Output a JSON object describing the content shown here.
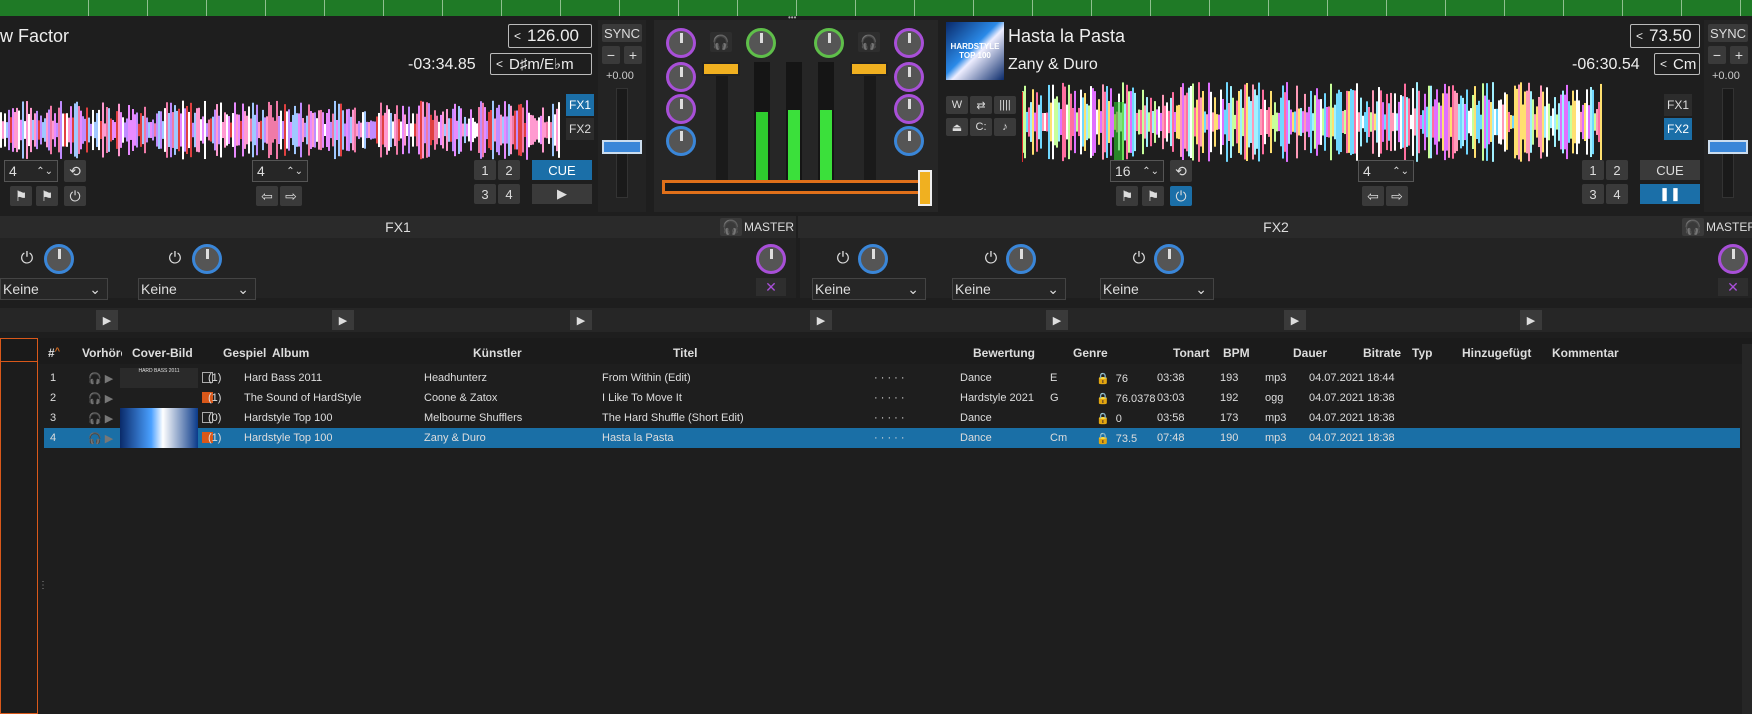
{
  "deck_left": {
    "title": "w Factor",
    "bpm": "126.00",
    "time": "-03:34.85",
    "key": "D♯m/E♭m",
    "pitch": "+0.00",
    "sync": "SYNC",
    "fx1": "FX1",
    "fx2": "FX2",
    "cue": "CUE",
    "loop_a": "4",
    "loop_b": "4",
    "hot": [
      "1",
      "2",
      "3",
      "4"
    ]
  },
  "deck_right": {
    "title": "Hasta la Pasta",
    "artist": "Zany & Duro",
    "bpm": "73.50",
    "time": "-06:30.54",
    "key": "Cm",
    "pitch": "+0.00",
    "sync": "SYNC",
    "fx1": "FX1",
    "fx2": "FX2",
    "cue": "CUE",
    "loop_a": "16",
    "loop_b": "4",
    "hot": [
      "1",
      "2",
      "3",
      "4"
    ],
    "cover_text": "HARDSTYLE TOP 100"
  },
  "fx": {
    "left_title": "FX1",
    "right_title": "FX2",
    "master": "MASTER",
    "select": "Keine"
  },
  "library": {
    "columns": [
      "#",
      "Vorhöre",
      "Cover-Bild",
      "Gespielt",
      "Album",
      "Künstler",
      "Titel",
      "Bewertung",
      "Genre",
      "Tonart",
      "BPM",
      "Dauer",
      "Bitrate",
      "Typ",
      "Hinzugefügt",
      "Kommentar"
    ],
    "rows": [
      {
        "n": "1",
        "played": "(1)",
        "checked": false,
        "album": "Hard Bass 2011",
        "artist": "Headhunterz",
        "title": "From Within (Edit)",
        "genre": "Dance",
        "key": "E",
        "bpm": "76",
        "dur": "03:38",
        "bitrate": "193",
        "type": "mp3",
        "added": "04.07.2021 18:44",
        "cover": "HARD BASS 2011"
      },
      {
        "n": "2",
        "played": "(1)",
        "checked": true,
        "album": "The Sound of HardStyle",
        "artist": "Coone & Zatox",
        "title": "I Like To Move It",
        "genre": "Hardstyle 2021",
        "key": "G",
        "bpm": "76.0378",
        "dur": "03:03",
        "bitrate": "192",
        "type": "ogg",
        "added": "04.07.2021 18:38",
        "cover": ""
      },
      {
        "n": "3",
        "played": "(0)",
        "checked": false,
        "album": "Hardstyle Top 100",
        "artist": "Melbourne Shufflers",
        "title": "The Hard Shuffle (Short Edit)",
        "genre": "Dance",
        "key": "",
        "bpm": "0",
        "dur": "03:58",
        "bitrate": "173",
        "type": "mp3",
        "added": "04.07.2021 18:38",
        "cover": ""
      },
      {
        "n": "4",
        "played": "(1)",
        "checked": true,
        "album": "Hardstyle Top 100",
        "artist": "Zany & Duro",
        "title": "Hasta la Pasta",
        "genre": "Dance",
        "key": "Cm",
        "bpm": "73.5",
        "dur": "07:48",
        "bitrate": "190",
        "type": "mp3",
        "added": "04.07.2021 18:38",
        "cover": ""
      }
    ],
    "rating": "· · · · ·"
  }
}
